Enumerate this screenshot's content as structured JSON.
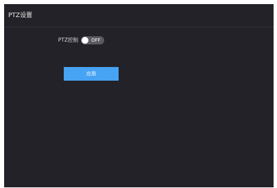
{
  "panel": {
    "title": "PTZ设置"
  },
  "ptz_control": {
    "label": "PTZ控制",
    "toggle_state": "OFF"
  },
  "actions": {
    "apply_label": "应用"
  },
  "colors": {
    "panel_background": "#222228",
    "toggle_off": "#5a5a63",
    "accent": "#47a3f3"
  },
  "icons": {
    "toggle": "toggle-switch-icon"
  }
}
